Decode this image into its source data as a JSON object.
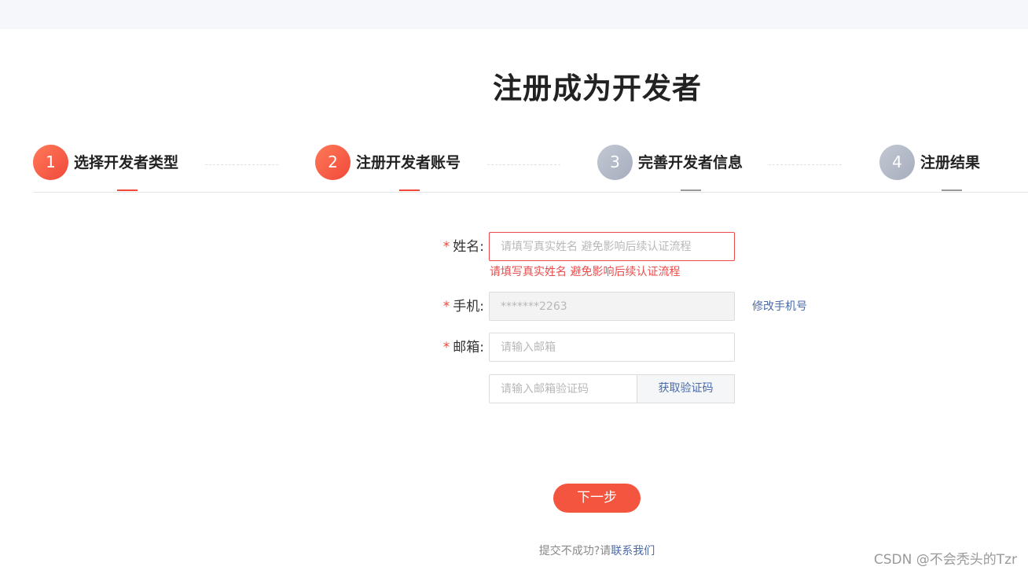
{
  "page": {
    "title": "注册成为开发者"
  },
  "steps": [
    {
      "number": "1",
      "label": "选择开发者类型",
      "state": "active"
    },
    {
      "number": "2",
      "label": "注册开发者账号",
      "state": "active"
    },
    {
      "number": "3",
      "label": "完善开发者信息",
      "state": "pending"
    },
    {
      "number": "4",
      "label": "注册结果",
      "state": "pending"
    }
  ],
  "form": {
    "required_mark": "*",
    "name": {
      "label": "姓名:",
      "value": "",
      "placeholder": "请填写真实姓名 避免影响后续认证流程",
      "error": "请填写真实姓名 避免影响后续认证流程"
    },
    "phone": {
      "label": "手机:",
      "value": "*******2263",
      "change_link": "修改手机号"
    },
    "email": {
      "label": "邮箱:",
      "value": "",
      "placeholder": "请输入邮箱"
    },
    "email_code": {
      "value": "",
      "placeholder": "请输入邮箱验证码",
      "button": "获取验证码"
    }
  },
  "actions": {
    "next": "下一步"
  },
  "footer": {
    "text": "提交不成功?请",
    "link": "联系我们"
  },
  "watermark": "CSDN @不会秃头的Tzr",
  "colors": {
    "accent": "#f0483a",
    "link": "#4a6aa8",
    "error": "#e94b4b",
    "pending_step": "#a6adbd"
  }
}
